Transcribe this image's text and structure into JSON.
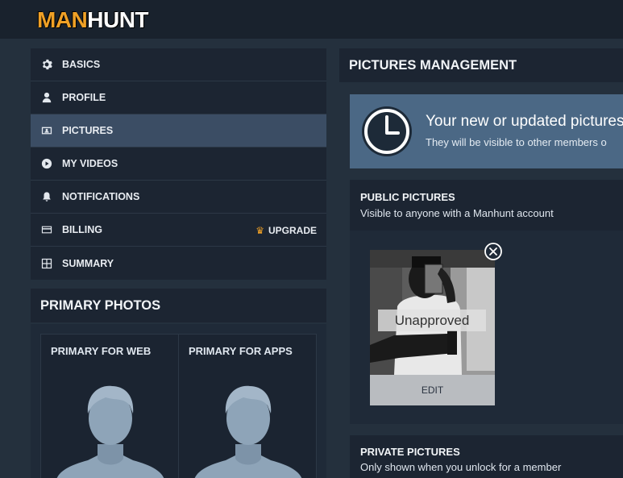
{
  "brand": {
    "part1": "MAN",
    "part2": "HUNT"
  },
  "sidebar": {
    "items": [
      {
        "label": "BASICS",
        "icon": "gear-icon"
      },
      {
        "label": "PROFILE",
        "icon": "user-icon"
      },
      {
        "label": "PICTURES",
        "icon": "picture-icon",
        "active": true
      },
      {
        "label": "MY VIDEOS",
        "icon": "play-icon"
      },
      {
        "label": "NOTIFICATIONS",
        "icon": "bell-icon"
      },
      {
        "label": "BILLING",
        "icon": "card-icon",
        "badge": "UPGRADE",
        "badge_icon": "crown-icon"
      },
      {
        "label": "SUMMARY",
        "icon": "grid-icon"
      }
    ]
  },
  "primary_photos": {
    "title": "PRIMARY PHOTOS",
    "web_label": "PRIMARY FOR WEB",
    "apps_label": "PRIMARY FOR APPS"
  },
  "main": {
    "title": "PICTURES MANAGEMENT",
    "notice": {
      "headline": "Your new or updated pictures",
      "subtext": "They will be visible to other members o"
    },
    "public": {
      "title": "PUBLIC PICTURES",
      "subtitle": "Visible to anyone with a Manhunt account",
      "photo_status": "Unapproved",
      "edit_label": "EDIT"
    },
    "private": {
      "title": "PRIVATE PICTURES",
      "subtitle": "Only shown when you unlock for a member"
    }
  },
  "colors": {
    "accent": "#f0a126",
    "active_nav": "#3b4d64",
    "notice_bg": "#4b6885",
    "panel_bg": "#1c2532"
  }
}
